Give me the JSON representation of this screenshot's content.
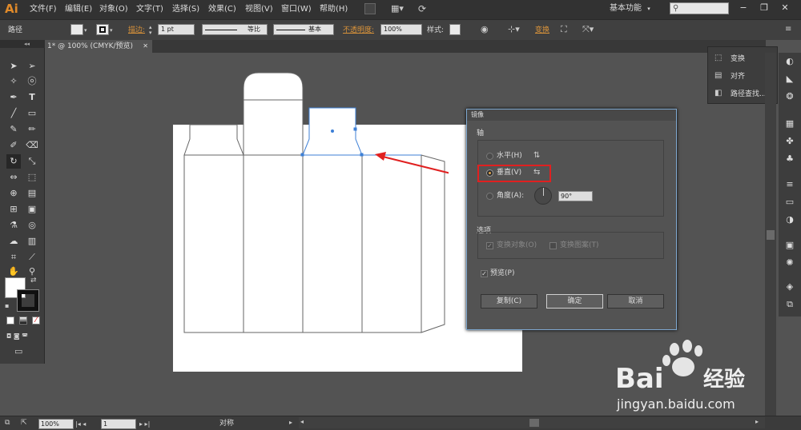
{
  "app": {
    "logo": "Ai"
  },
  "menubar": {
    "items": [
      "文件(F)",
      "编辑(E)",
      "对象(O)",
      "文字(T)",
      "选择(S)",
      "效果(C)",
      "视图(V)",
      "窗口(W)",
      "帮助(H)"
    ],
    "workspace_label": "基本功能",
    "window_buttons": [
      "−",
      "❐",
      "✕"
    ]
  },
  "controlbar": {
    "selection_label": "路径",
    "stroke_label": "描边:",
    "stroke_value": "1 pt",
    "profile_label": "等比",
    "brush_label": "基本",
    "opacity_label": "不透明度:",
    "opacity_value": "100%",
    "style_label": "样式:",
    "transform_label": "变换"
  },
  "document": {
    "tab_title": "1* @ 100% (CMYK/预览)",
    "close_glyph": "✕"
  },
  "mirror_dialog": {
    "title": "镜像",
    "axis_group_label": "轴",
    "horizontal_label": "水平(H)",
    "vertical_label": "垂直(V)",
    "angle_label": "角度(A):",
    "angle_value": "90°",
    "options_group_label": "选项",
    "transform_objects_label": "变换对象(O)",
    "transform_patterns_label": "变换图案(T)",
    "preview_label": "预览(P)",
    "copy_button": "复制(C)",
    "ok_button": "确定",
    "cancel_button": "取消"
  },
  "flyout_panel": {
    "items": [
      "变换",
      "对齐",
      "路径查找..."
    ]
  },
  "statusbar": {
    "zoom": "100%",
    "page": "1",
    "status_text": "对称"
  },
  "watermark": {
    "brand": "Bai",
    "brand2": "经验",
    "url": "jingyan.baidu.com"
  },
  "colors": {
    "accent_orange": "#d8923a",
    "highlight_red": "#e02020",
    "selection_blue": "#3c7fd6",
    "dialog_border": "#7fa9d1"
  }
}
